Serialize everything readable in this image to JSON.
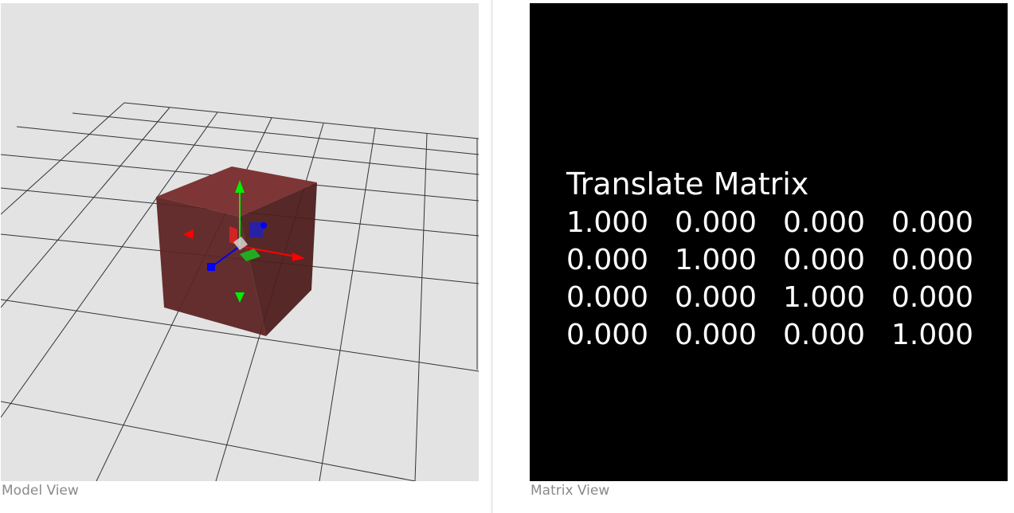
{
  "model_view": {
    "caption": "Model View",
    "colors": {
      "background": "#e3e3e3",
      "grid": "#333333",
      "cube_front": "#5e2424",
      "cube_top": "#7e3535",
      "cube_side": "#4a1b1b",
      "axis_x": "#ff0000",
      "axis_y": "#00ee00",
      "axis_z": "#0000ff"
    },
    "icons": [
      "translate-gizmo-icon"
    ]
  },
  "matrix_view": {
    "caption": "Matrix View",
    "title": "Translate Matrix",
    "rows": [
      [
        "1.000",
        "0.000",
        "0.000",
        "0.000"
      ],
      [
        "0.000",
        "1.000",
        "0.000",
        "0.000"
      ],
      [
        "0.000",
        "0.000",
        "1.000",
        "0.000"
      ],
      [
        "0.000",
        "0.000",
        "0.000",
        "1.000"
      ]
    ]
  }
}
